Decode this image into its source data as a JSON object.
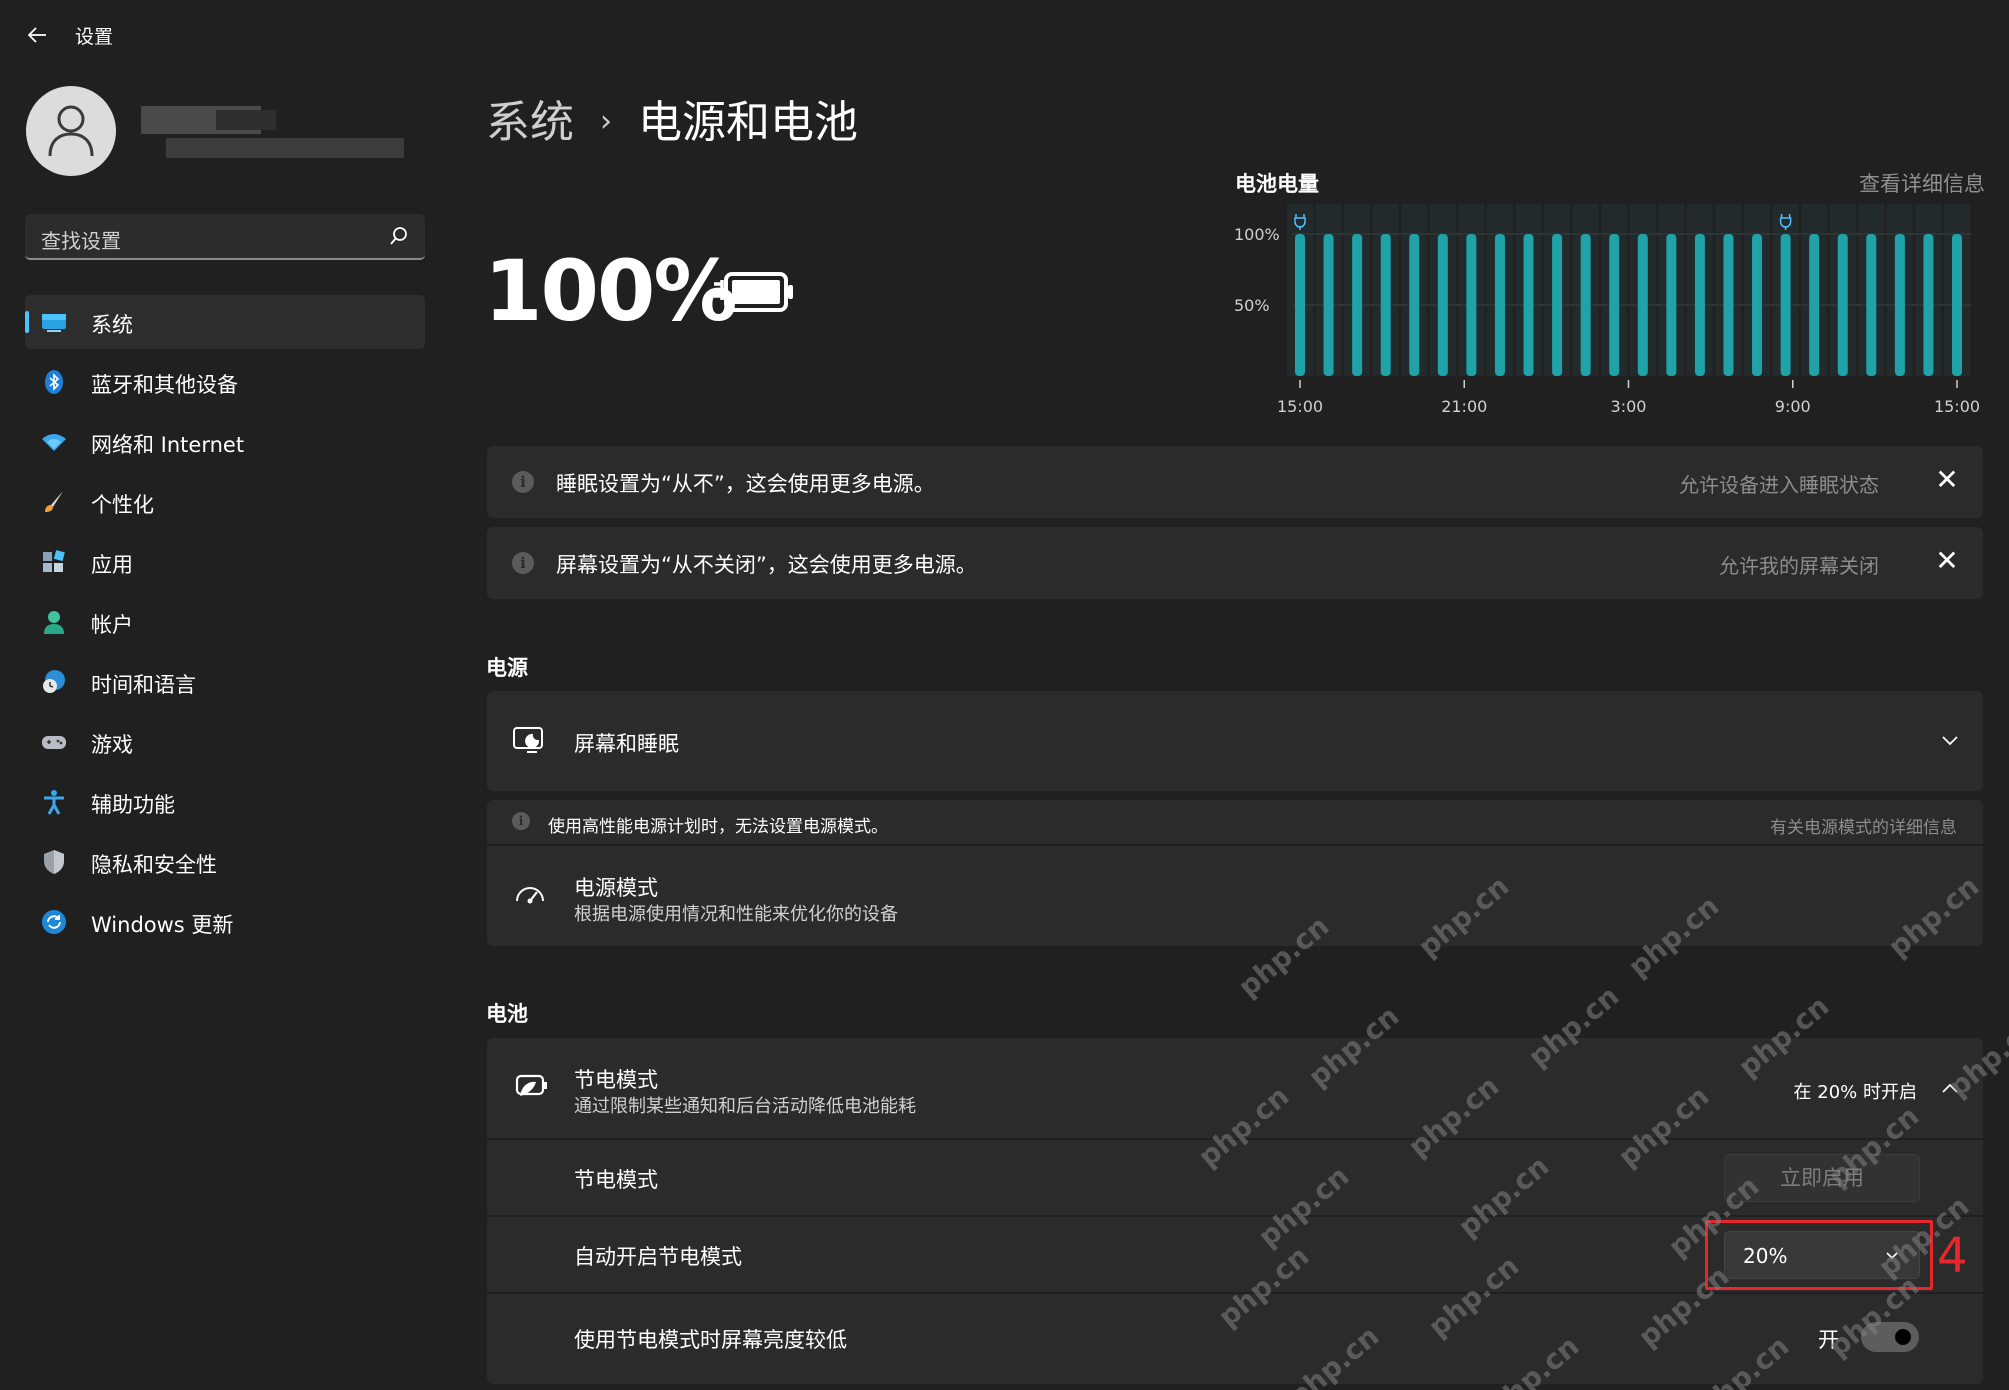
{
  "window": {
    "title": "设置",
    "back_icon": "arrow-left-icon"
  },
  "sidebar": {
    "search_placeholder": "查找设置",
    "items": [
      {
        "label": "系统",
        "icon": "monitor-icon",
        "active": true
      },
      {
        "label": "蓝牙和其他设备",
        "icon": "bluetooth-icon"
      },
      {
        "label": "网络和 Internet",
        "icon": "wifi-icon"
      },
      {
        "label": "个性化",
        "icon": "brush-icon"
      },
      {
        "label": "应用",
        "icon": "apps-icon"
      },
      {
        "label": "帐户",
        "icon": "account-icon"
      },
      {
        "label": "时间和语言",
        "icon": "globe-clock-icon"
      },
      {
        "label": "游戏",
        "icon": "gamepad-icon"
      },
      {
        "label": "辅助功能",
        "icon": "accessibility-icon"
      },
      {
        "label": "隐私和安全性",
        "icon": "shield-icon"
      },
      {
        "label": "Windows 更新",
        "icon": "update-icon"
      }
    ]
  },
  "main": {
    "breadcrumb": {
      "parent": "系统",
      "separator": "›",
      "current": "电源和电池"
    },
    "battery": {
      "percent": "100%"
    },
    "battery_chart": {
      "title": "电池电量",
      "details_link": "查看详细信息"
    },
    "notices": [
      {
        "text": "睡眠设置为“从不”，这会使用更多电源。",
        "action": "允许设备进入睡眠状态"
      },
      {
        "text": "屏幕设置为“从不关闭”，这会使用更多电源。",
        "action": "允许我的屏幕关闭"
      }
    ],
    "power_section": {
      "title": "电源",
      "screen_sleep": {
        "label": "屏幕和睡眠"
      },
      "power_mode_notice": {
        "text": "使用高性能电源计划时，无法设置电源模式。",
        "link": "有关电源模式的详细信息"
      },
      "power_mode": {
        "label": "电源模式",
        "description": "根据电源使用情况和性能来优化你的设备"
      }
    },
    "battery_section": {
      "title": "电池",
      "saver": {
        "label": "节电模式",
        "description": "通过限制某些通知和后台活动降低电池能耗",
        "status": "在 20% 时开启"
      },
      "saver_now": {
        "label": "节电模式",
        "button": "立即启用"
      },
      "auto_saver": {
        "label": "自动开启节电模式",
        "value": "20%"
      },
      "lower_brightness": {
        "label": "使用节电模式时屏幕亮度较低",
        "toggle_label": "开",
        "toggle_on": true
      }
    },
    "annotation": {
      "step": "4"
    }
  },
  "watermark_text": "php.cn",
  "colors": {
    "accent": "#4cc2ff",
    "chart_bar": "#1fa3a8",
    "highlight": "#e8262b",
    "background": "#202020",
    "card": "#2b2b2b"
  },
  "chart_data": {
    "type": "bar",
    "title": "电池电量",
    "x_tick_labels": [
      "15:00",
      "21:00",
      "3:00",
      "9:00",
      "15:00"
    ],
    "y_tick_labels": [
      "100%",
      "50%"
    ],
    "ylim": [
      0,
      100
    ],
    "bar_count": 24,
    "values": [
      100,
      100,
      100,
      100,
      100,
      100,
      100,
      100,
      100,
      100,
      100,
      100,
      100,
      100,
      100,
      100,
      100,
      100,
      100,
      100,
      100,
      100,
      100,
      100
    ],
    "charging_markers": [
      0,
      17
    ],
    "grid": true
  }
}
